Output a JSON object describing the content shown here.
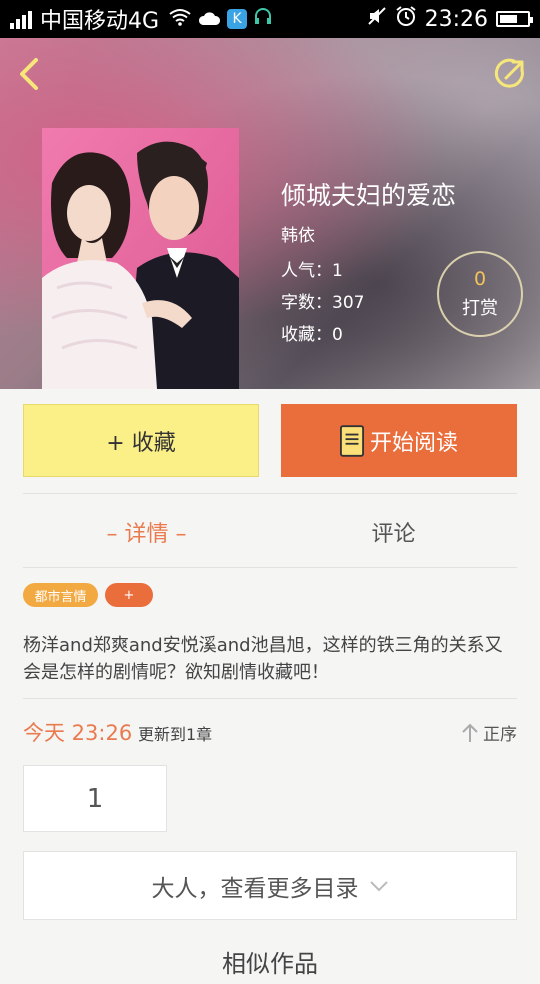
{
  "status_bar": {
    "carrier": "中国移动4G",
    "time": "23:26",
    "k_badge": "K",
    "icons": [
      "signal-icon",
      "wifi-icon",
      "cloud-icon",
      "k-app-icon",
      "headset-icon",
      "mute-icon",
      "alarm-icon",
      "battery-icon"
    ]
  },
  "book": {
    "title": "倾城夫妇的爱恋",
    "author": "韩依",
    "popularity_label": "人气：",
    "popularity": "1",
    "words_label": "字数：",
    "words": "307",
    "favorites_label": "收藏：",
    "favorites": "0",
    "cover_icon": "cover-image"
  },
  "tip": {
    "count": "0",
    "label": "打赏"
  },
  "actions": {
    "favorite": "+ 收藏",
    "read": "开始阅读"
  },
  "tabs": [
    {
      "label": "– 详情 –",
      "active": true
    },
    {
      "label": "评论",
      "active": false
    }
  ],
  "tags": {
    "genre": "都市言情",
    "add": "+"
  },
  "description": "杨洋and郑爽and安悦溪and池昌旭，这样的铁三角的关系又会是怎样的剧情呢？欲知剧情收藏吧！",
  "update": {
    "time": "今天 23:26",
    "text": "更新到1章",
    "order": "正序"
  },
  "chapters": [
    "1"
  ],
  "more_catalog": "大人，查看更多目录",
  "next_section_title": "相似作品",
  "colors": {
    "accent": "#ea6d3c",
    "favorite_bg": "#fbf088",
    "tab_active": "#ea7a4f",
    "tag_genre": "#f2a941"
  }
}
